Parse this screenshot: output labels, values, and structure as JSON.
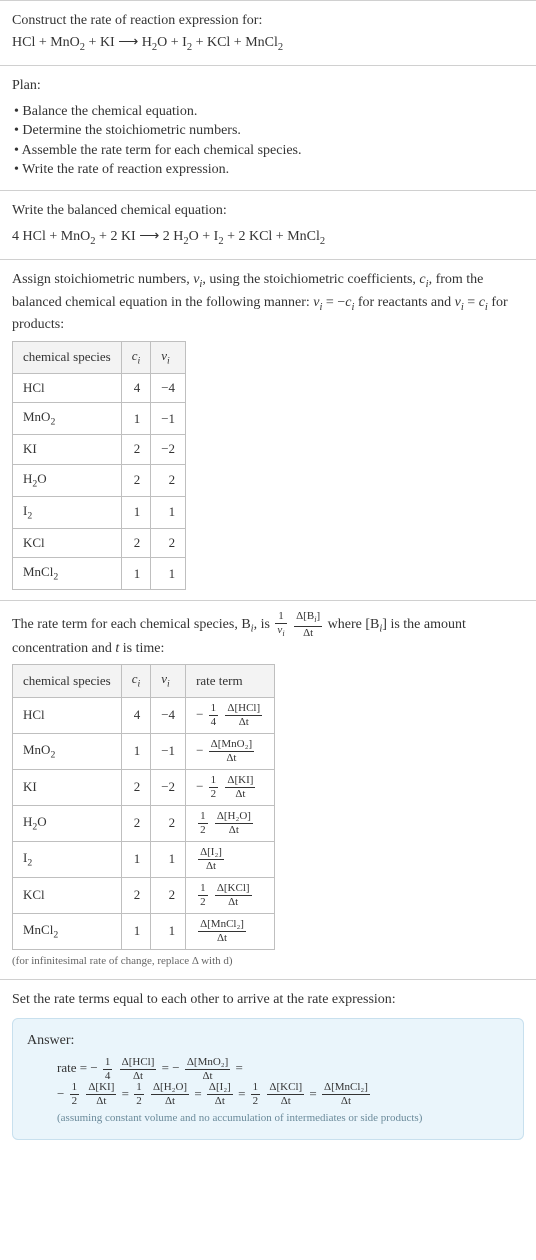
{
  "chart_data": [
    {
      "type": "table",
      "title": "Stoichiometric numbers",
      "columns": [
        "chemical species",
        "c_i",
        "ν_i"
      ],
      "rows": [
        [
          "HCl",
          4,
          -4
        ],
        [
          "MnO2",
          1,
          -1
        ],
        [
          "KI",
          2,
          -2
        ],
        [
          "H2O",
          2,
          2
        ],
        [
          "I2",
          1,
          1
        ],
        [
          "KCl",
          2,
          2
        ],
        [
          "MnCl2",
          1,
          1
        ]
      ]
    },
    {
      "type": "table",
      "title": "Rate terms per species",
      "columns": [
        "chemical species",
        "c_i",
        "ν_i",
        "rate term"
      ],
      "rows": [
        [
          "HCl",
          4,
          -4,
          "-(1/4) Δ[HCl]/Δt"
        ],
        [
          "MnO2",
          1,
          -1,
          "-Δ[MnO2]/Δt"
        ],
        [
          "KI",
          2,
          -2,
          "-(1/2) Δ[KI]/Δt"
        ],
        [
          "H2O",
          2,
          2,
          "(1/2) Δ[H2O]/Δt"
        ],
        [
          "I2",
          1,
          1,
          "Δ[I2]/Δt"
        ],
        [
          "KCl",
          2,
          2,
          "(1/2) Δ[KCl]/Δt"
        ],
        [
          "MnCl2",
          1,
          1,
          "Δ[MnCl2]/Δt"
        ]
      ]
    }
  ],
  "header": {
    "prompt": "Construct the rate of reaction expression for:",
    "equation_lhs": "HCl + MnO",
    "equation_lhs2_sub": "2",
    "equation_lhs3": " + KI ⟶ H",
    "equation_lhs4_sub": "2",
    "equation_lhs5": "O + I",
    "equation_lhs6_sub": "2",
    "equation_lhs7": " + KCl + MnCl",
    "equation_lhs8_sub": "2"
  },
  "plan": {
    "title": "Plan:",
    "items": [
      "• Balance the chemical equation.",
      "• Determine the stoichiometric numbers.",
      "• Assemble the rate term for each chemical species.",
      "• Write the rate of reaction expression."
    ]
  },
  "balanced": {
    "intro": "Write the balanced chemical equation:",
    "eq_p1": "4 HCl + MnO",
    "eq_p2_sub": "2",
    "eq_p3": " + 2 KI ⟶ 2 H",
    "eq_p4_sub": "2",
    "eq_p5": "O + I",
    "eq_p6_sub": "2",
    "eq_p7": " + 2 KCl + MnCl",
    "eq_p8_sub": "2"
  },
  "stoich": {
    "intro_p1": "Assign stoichiometric numbers, ",
    "intro_nu": "ν",
    "intro_i1": "i",
    "intro_p2": ", using the stoichiometric coefficients, ",
    "intro_c": "c",
    "intro_i2": "i",
    "intro_p3": ", from the balanced chemical equation in the following manner: ",
    "intro_rel1": "ν",
    "intro_rel1_i": "i",
    "intro_rel2": " = −",
    "intro_rel3": "c",
    "intro_rel3_i": "i",
    "intro_p4": " for reactants and ",
    "intro_rel4": "ν",
    "intro_rel4_i": "i",
    "intro_rel5": " = ",
    "intro_rel6": "c",
    "intro_rel6_i": "i",
    "intro_p5": " for products:",
    "col1": "chemical species",
    "col2_c": "c",
    "col2_i": "i",
    "col3_nu": "ν",
    "col3_i": "i",
    "rows": [
      {
        "sp_a": "HCl",
        "sp_b": "",
        "c": "4",
        "nu": "−4"
      },
      {
        "sp_a": "MnO",
        "sp_b": "2",
        "c": "1",
        "nu": "−1"
      },
      {
        "sp_a": "KI",
        "sp_b": "",
        "c": "2",
        "nu": "−2"
      },
      {
        "sp_a": "H",
        "sp_b": "2",
        "sp_c": "O",
        "c": "2",
        "nu": "2"
      },
      {
        "sp_a": "I",
        "sp_b": "2",
        "c": "1",
        "nu": "1"
      },
      {
        "sp_a": "KCl",
        "sp_b": "",
        "c": "2",
        "nu": "2"
      },
      {
        "sp_a": "MnCl",
        "sp_b": "2",
        "c": "1",
        "nu": "1"
      }
    ]
  },
  "rateterm": {
    "intro_p1": "The rate term for each chemical species, B",
    "intro_i1": "i",
    "intro_p2": ", is ",
    "frac1_num": "1",
    "frac1_den_nu": "ν",
    "frac1_den_i": "i",
    "frac2_num_a": "Δ[B",
    "frac2_num_i": "i",
    "frac2_num_b": "]",
    "frac2_den": "Δt",
    "intro_p3": " where [B",
    "intro_i2": "i",
    "intro_p4": "] is the amount concentration and ",
    "intro_t": "t",
    "intro_p5": " is time:",
    "col1": "chemical species",
    "col2_c": "c",
    "col2_i": "i",
    "col3_nu": "ν",
    "col3_i": "i",
    "col4": "rate term",
    "rows": [
      {
        "sp_a": "HCl",
        "sp_b": "",
        "c": "4",
        "nu": "−4",
        "pre": "− ",
        "f1n": "1",
        "f1d": "4",
        "f2n": "Δ[HCl]",
        "f2d": "Δt"
      },
      {
        "sp_a": "MnO",
        "sp_b": "2",
        "c": "1",
        "nu": "−1",
        "pre": "− ",
        "f1n": "",
        "f1d": "",
        "f2n": "Δ[MnO₂]",
        "f2d": "Δt"
      },
      {
        "sp_a": "KI",
        "sp_b": "",
        "c": "2",
        "nu": "−2",
        "pre": "− ",
        "f1n": "1",
        "f1d": "2",
        "f2n": "Δ[KI]",
        "f2d": "Δt"
      },
      {
        "sp_a": "H",
        "sp_b": "2",
        "sp_c": "O",
        "c": "2",
        "nu": "2",
        "pre": "",
        "f1n": "1",
        "f1d": "2",
        "f2n": "Δ[H₂O]",
        "f2d": "Δt"
      },
      {
        "sp_a": "I",
        "sp_b": "2",
        "c": "1",
        "nu": "1",
        "pre": "",
        "f1n": "",
        "f1d": "",
        "f2n": "Δ[I₂]",
        "f2d": "Δt"
      },
      {
        "sp_a": "KCl",
        "sp_b": "",
        "c": "2",
        "nu": "2",
        "pre": "",
        "f1n": "1",
        "f1d": "2",
        "f2n": "Δ[KCl]",
        "f2d": "Δt"
      },
      {
        "sp_a": "MnCl",
        "sp_b": "2",
        "c": "1",
        "nu": "1",
        "pre": "",
        "f1n": "",
        "f1d": "",
        "f2n": "Δ[MnCl₂]",
        "f2d": "Δt"
      }
    ],
    "note": "(for infinitesimal rate of change, replace Δ with d)"
  },
  "final": {
    "intro": "Set the rate terms equal to each other to arrive at the rate expression:",
    "answer_title": "Answer:",
    "line1_rate": "rate = − ",
    "line1_f1n": "1",
    "line1_f1d": "4",
    "line1_f2n": "Δ[HCl]",
    "line1_f2d": "Δt",
    "line1_eq1": " = − ",
    "line1_f3n": "Δ[MnO₂]",
    "line1_f3d": "Δt",
    "line1_eq2": " =",
    "line2_pre": "− ",
    "line2_f1n": "1",
    "line2_f1d": "2",
    "line2_f2n": "Δ[KI]",
    "line2_f2d": "Δt",
    "line2_eq1": " = ",
    "line2_f3n": "1",
    "line2_f3d": "2",
    "line2_f4n": "Δ[H₂O]",
    "line2_f4d": "Δt",
    "line2_eq2": " = ",
    "line2_f5n": "Δ[I₂]",
    "line2_f5d": "Δt",
    "line2_eq3": " = ",
    "line2_f6n": "1",
    "line2_f6d": "2",
    "line2_f7n": "Δ[KCl]",
    "line2_f7d": "Δt",
    "line2_eq4": " = ",
    "line2_f8n": "Δ[MnCl₂]",
    "line2_f8d": "Δt",
    "note": "(assuming constant volume and no accumulation of intermediates or side products)"
  }
}
